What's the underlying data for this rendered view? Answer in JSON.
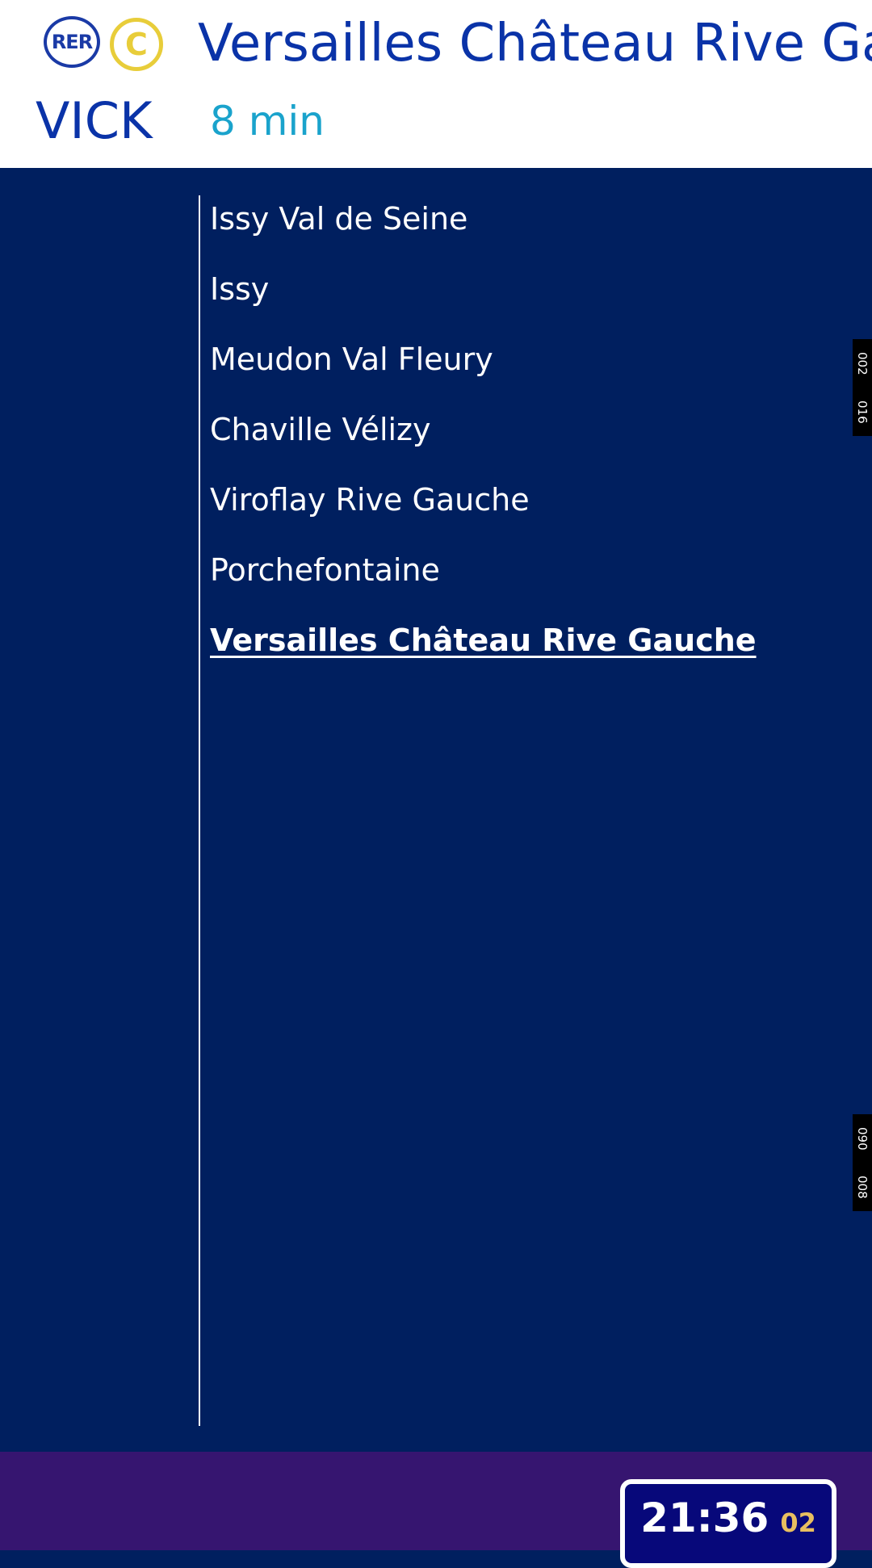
{
  "header": {
    "network_logo_text": "RER",
    "line_letter": "C",
    "destination": "Versailles Château Rive Gauche",
    "mission_code": "VICK",
    "wait_time": "8 min"
  },
  "stops": [
    {
      "name": "Issy Val de Seine"
    },
    {
      "name": "Issy"
    },
    {
      "name": "Meudon Val Fleury"
    },
    {
      "name": "Chaville Vélizy"
    },
    {
      "name": "Viroflay Rive Gauche"
    },
    {
      "name": "Porchefontaine"
    },
    {
      "name": "Versailles Château Rive Gauche",
      "terminus": true
    }
  ],
  "markers": [
    {
      "top": "002",
      "bottom": "016"
    },
    {
      "top": "090",
      "bottom": "008"
    }
  ],
  "clock": {
    "time": "21:36",
    "seconds": "02"
  },
  "colors": {
    "background": "#001f5f",
    "header_text": "#0a33a8",
    "wait_time": "#1aa3cc",
    "line_c": "#e8cd3a",
    "footer": "#361570",
    "clock_bg": "#07087a",
    "clock_seconds": "#e8bf60"
  }
}
